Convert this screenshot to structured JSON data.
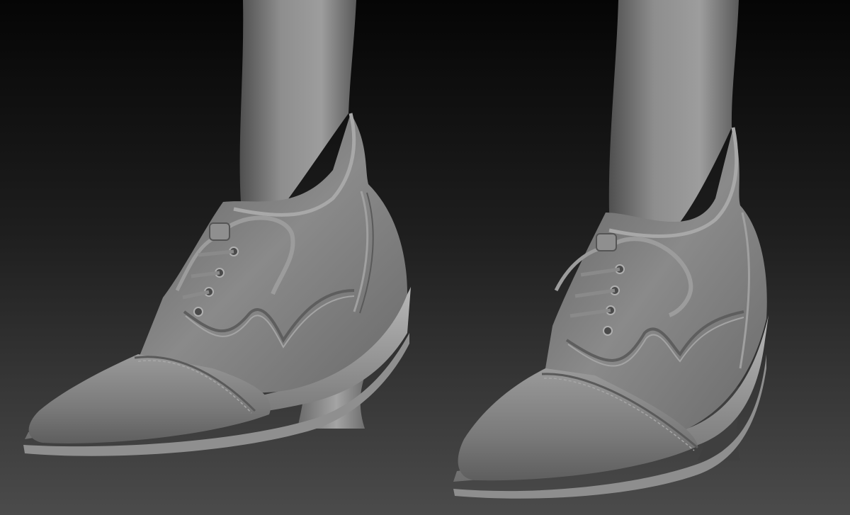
{
  "scene": {
    "subject": "sculpt-render",
    "material": "grey-clay",
    "colors": {
      "background_top": "#060606",
      "background_bottom": "#4a4a4a",
      "clay_light": "#a9a9a9",
      "clay_mid": "#7c7c7c",
      "clay_dark": "#3a3a3a",
      "sole_edge": "#b5b5b5"
    },
    "icons": [
      "left-shoe",
      "right-shoe",
      "left-leg",
      "right-leg"
    ]
  }
}
